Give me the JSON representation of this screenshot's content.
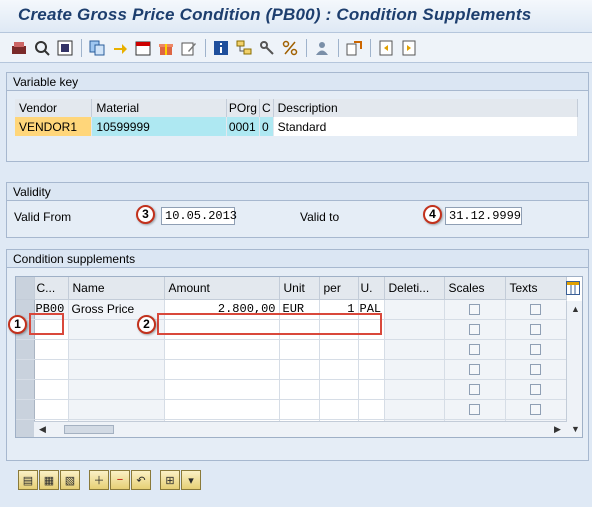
{
  "window": {
    "title": "Create Gross Price Condition (PB00) : Condition Supplements"
  },
  "toolbar": {
    "icons": [
      "display-change-icon",
      "overview-icon",
      "key-combination-icon",
      "copy-icon",
      "goto-icon",
      "validity-periods-icon",
      "additional-data-icon",
      "edit-icon",
      "info-icon",
      "hierarchy-icon",
      "keys-icon",
      "percentage-icon",
      "person-icon",
      "export-icon",
      "first-page-icon",
      "last-page-icon"
    ]
  },
  "variable_key": {
    "title": "Variable key",
    "headers": [
      "Vendor",
      "Material",
      "POrg",
      "C",
      "Description"
    ],
    "row": [
      "VENDOR1",
      "10599999",
      "0001",
      "0",
      "Standard"
    ]
  },
  "validity": {
    "title": "Validity",
    "valid_from_label": "Valid From",
    "valid_from": "10.05.2013",
    "valid_to_label": "Valid to",
    "valid_to": "31.12.9999"
  },
  "markers": [
    "1",
    "2",
    "3",
    "4"
  ],
  "condition_supplements": {
    "title": "Condition supplements",
    "headers": [
      "C...",
      "Name",
      "Amount",
      "Unit",
      "per",
      "U.",
      "Deleti...",
      "Scales",
      "Texts"
    ],
    "rows": [
      {
        "ctype": "PB00",
        "name": "Gross Price",
        "amount": "2.800,00",
        "unit": "EUR",
        "per": "1",
        "uom": "PAL"
      }
    ]
  },
  "colors": {
    "highlight_vendor": "#ffd67a",
    "highlight_key": "#aee8f2",
    "marker_border": "#c2311c"
  }
}
